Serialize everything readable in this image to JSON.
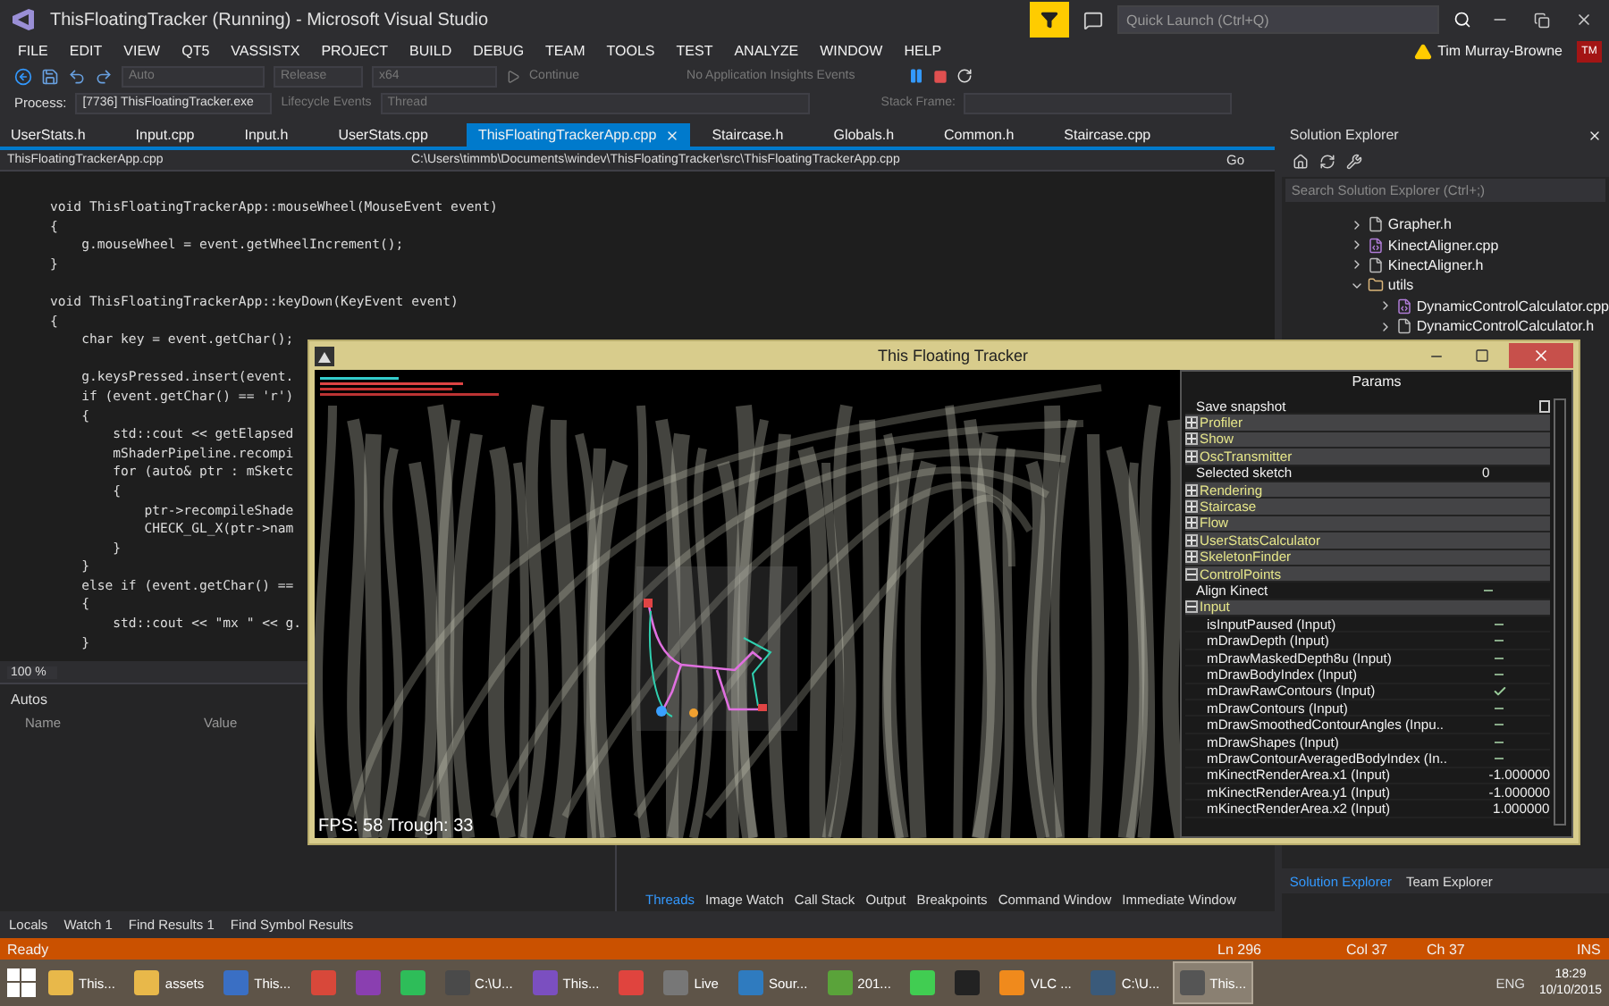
{
  "window": {
    "title": "ThisFloatingTracker (Running) - Microsoft Visual Studio"
  },
  "quick_launch": {
    "placeholder": "Quick Launch (Ctrl+Q)"
  },
  "user": {
    "name": "Tim Murray-Browne",
    "initials": "TM"
  },
  "menu": [
    "FILE",
    "EDIT",
    "VIEW",
    "QT5",
    "VASSISTX",
    "PROJECT",
    "BUILD",
    "DEBUG",
    "TEAM",
    "TOOLS",
    "TEST",
    "ANALYZE",
    "WINDOW",
    "HELP"
  ],
  "toolbar": {
    "solution_config": "Auto",
    "configuration": "Release",
    "platform": "x64",
    "continue": "Continue",
    "insights": "No Application Insights Events"
  },
  "process_bar": {
    "label": "Process:",
    "process": "[7736] ThisFloatingTracker.exe",
    "lifecycle": "Lifecycle Events",
    "thread": "Thread",
    "stack_frame": "Stack Frame:"
  },
  "doc_tabs": [
    {
      "label": "UserStats.h",
      "selected": false
    },
    {
      "label": "Input.cpp",
      "selected": false
    },
    {
      "label": "Input.h",
      "selected": false
    },
    {
      "label": "UserStats.cpp",
      "selected": false
    },
    {
      "label": "ThisFloatingTrackerApp.cpp",
      "selected": true
    },
    {
      "label": "Staircase.h",
      "selected": false
    },
    {
      "label": "Globals.h",
      "selected": false
    },
    {
      "label": "Common.h",
      "selected": false
    },
    {
      "label": "Staircase.cpp",
      "selected": false
    }
  ],
  "nav_bar": {
    "scope": "ThisFloatingTrackerApp.cpp",
    "path": "C:\\Users\\timmb\\Documents\\windev\\ThisFloatingTracker\\src\\ThisFloatingTrackerApp.cpp",
    "go": "Go"
  },
  "code_lines": [
    {
      "text": "void ThisFloatingTrackerApp::mouseWheel(MouseEvent event)"
    },
    {
      "text": "{"
    },
    {
      "text": "    g.mouseWheel = event.getWheelIncrement();"
    },
    {
      "text": "}"
    },
    {
      "text": "void ThisFloatingTrackerApp::keyDown(KeyEvent event)",
      "gap_before": true
    },
    {
      "text": "{"
    },
    {
      "text": "    char key = event.getChar();"
    },
    {
      "text": "    g.keysPressed.insert(event.",
      "gap_before": true
    },
    {
      "text": "    if (event.getChar() == 'r')"
    },
    {
      "text": "    {"
    },
    {
      "text": "        std::cout << getElapsed"
    },
    {
      "text": "        mShaderPipeline.recompi"
    },
    {
      "text": "        for (auto& ptr : mSketc"
    },
    {
      "text": "        {"
    },
    {
      "text": "            ptr->recompileShade"
    },
    {
      "text": "            CHECK_GL_X(ptr->nam"
    },
    {
      "text": "        }"
    },
    {
      "text": "    }"
    },
    {
      "text": "    else if (event.getChar() =="
    },
    {
      "text": "    {"
    },
    {
      "text": "        std::cout << \"mx \" << g."
    },
    {
      "text": "    }"
    }
  ],
  "zoom": "100 %",
  "autos": {
    "title": "Autos",
    "columns": [
      "Name",
      "Value"
    ]
  },
  "debug_tabs": [
    {
      "label": "Threads",
      "selected": true
    },
    {
      "label": "Image Watch",
      "selected": false
    },
    {
      "label": "Call Stack",
      "selected": false
    },
    {
      "label": "Output",
      "selected": false
    },
    {
      "label": "Breakpoints",
      "selected": false
    },
    {
      "label": "Command Window",
      "selected": false
    },
    {
      "label": "Immediate Window",
      "selected": false
    }
  ],
  "bottom_tabs": [
    {
      "label": "Locals",
      "selected": false
    },
    {
      "label": "Watch 1",
      "selected": false
    },
    {
      "label": "Find Results 1",
      "selected": false
    },
    {
      "label": "Find Symbol Results",
      "selected": false
    }
  ],
  "solution_explorer": {
    "title": "Solution Explorer",
    "search": {
      "placeholder": "Search Solution Explorer (Ctrl+;)"
    },
    "tree": [
      {
        "label": "Grapher.h",
        "kind": "header"
      },
      {
        "label": "KinectAligner.cpp",
        "kind": "source"
      },
      {
        "label": "KinectAligner.h",
        "kind": "header"
      },
      {
        "label": "utils",
        "kind": "folder",
        "expanded": true,
        "children": [
          {
            "label": "DynamicControlCalculator.cpp",
            "kind": "source"
          },
          {
            "label": "DynamicControlCalculator.h",
            "kind": "header"
          }
        ]
      }
    ],
    "tabs": [
      {
        "label": "Solution Explorer",
        "selected": true
      },
      {
        "label": "Team Explorer",
        "selected": false
      }
    ]
  },
  "tracker_window": {
    "title": "This Floating Tracker",
    "fps": "FPS: 58 Trough: 33",
    "params": {
      "title": "Params",
      "rows": [
        {
          "kind": "action",
          "label": "Save snapshot",
          "checked": false
        },
        {
          "kind": "group",
          "label": "Profiler",
          "expanded": false
        },
        {
          "kind": "group",
          "label": "Show",
          "expanded": false
        },
        {
          "kind": "group",
          "label": "OscTransmitter",
          "expanded": false
        },
        {
          "kind": "value",
          "label": "Selected sketch",
          "value": "0"
        },
        {
          "kind": "group",
          "label": "Rendering",
          "expanded": false
        },
        {
          "kind": "group",
          "label": "Staircase",
          "expanded": false
        },
        {
          "kind": "group",
          "label": "Flow",
          "expanded": false
        },
        {
          "kind": "group",
          "label": "UserStatsCalculator",
          "expanded": false
        },
        {
          "kind": "group",
          "label": "SkeletonFinder",
          "expanded": false
        },
        {
          "kind": "group",
          "label": "ControlPoints",
          "expanded": true
        },
        {
          "kind": "bool",
          "label": "Align Kinect",
          "checked": false
        },
        {
          "kind": "group",
          "label": "Input",
          "expanded": true,
          "children": [
            {
              "kind": "bool",
              "label": "isInputPaused (Input)",
              "checked": false
            },
            {
              "kind": "bool",
              "label": "mDrawDepth (Input)",
              "checked": false
            },
            {
              "kind": "bool",
              "label": "mDrawMaskedDepth8u (Input)",
              "checked": false
            },
            {
              "kind": "bool",
              "label": "mDrawBodyIndex (Input)",
              "checked": false
            },
            {
              "kind": "bool",
              "label": "mDrawRawContours (Input)",
              "checked": true
            },
            {
              "kind": "bool",
              "label": "mDrawContours (Input)",
              "checked": false
            },
            {
              "kind": "bool",
              "label": "mDrawSmoothedContourAngles (Inpu..",
              "checked": false
            },
            {
              "kind": "bool",
              "label": "mDrawShapes (Input)",
              "checked": false
            },
            {
              "kind": "bool",
              "label": "mDrawContourAveragedBodyIndex (In..",
              "checked": false
            },
            {
              "kind": "value",
              "label": "mKinectRenderArea.x1 (Input)",
              "value": "-1.000000"
            },
            {
              "kind": "value",
              "label": "mKinectRenderArea.y1 (Input)",
              "value": "-1.000000"
            },
            {
              "kind": "value",
              "label": "mKinectRenderArea.x2 (Input)",
              "value": "1.000000"
            }
          ]
        }
      ]
    }
  },
  "status_bar": {
    "state": "Ready",
    "line": "Ln 296",
    "col": "Col 37",
    "ch": "Ch 37",
    "mode": "INS"
  },
  "taskbar": {
    "items": [
      {
        "label": "This...",
        "color": "#e8b84a",
        "selected": false
      },
      {
        "label": "assets",
        "color": "#e8b84a",
        "selected": false
      },
      {
        "label": "This...",
        "color": "#3a6fc4",
        "selected": false
      },
      {
        "color": "#d8483a",
        "selected": false
      },
      {
        "color": "#8a3fb0",
        "selected": false
      },
      {
        "color": "#2ebd59",
        "selected": false
      },
      {
        "label": "C:\\U...",
        "color": "#4a4a4a",
        "selected": false
      },
      {
        "label": "This...",
        "color": "#7b4fc0",
        "selected": false
      },
      {
        "color": "#e0443e",
        "selected": false
      },
      {
        "label": "Live",
        "color": "#777777",
        "selected": false
      },
      {
        "label": "Sour...",
        "color": "#2f7bbf",
        "selected": false
      },
      {
        "label": "201...",
        "color": "#5aa33a",
        "selected": false
      },
      {
        "color": "#41cd52",
        "selected": false
      },
      {
        "color": "#222222",
        "selected": false
      },
      {
        "label": "VLC ...",
        "color": "#f08a1c",
        "selected": false
      },
      {
        "label": "C:\\U...",
        "color": "#3a5a7a",
        "selected": false
      },
      {
        "label": "This...",
        "color": "#555555",
        "selected": true
      }
    ],
    "language": "ENG",
    "time": "18:29",
    "date": "10/10/2015"
  }
}
